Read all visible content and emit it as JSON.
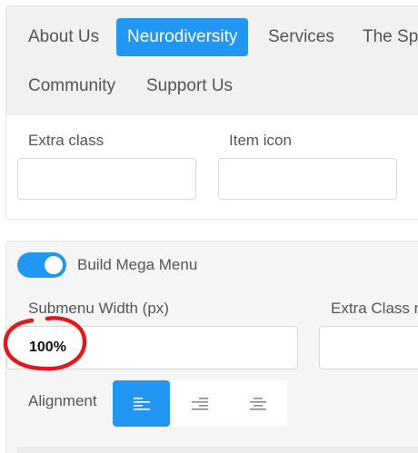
{
  "nav": {
    "items": [
      {
        "label": "About Us",
        "active": false
      },
      {
        "label": "Neurodiversity",
        "active": true
      },
      {
        "label": "Services",
        "active": false
      },
      {
        "label": "The Sp",
        "active": false
      },
      {
        "label": "Community",
        "active": false
      },
      {
        "label": "Support Us",
        "active": false
      }
    ]
  },
  "item_settings": {
    "extra_class_label": "Extra class",
    "extra_class_value": "",
    "item_icon_label": "Item icon",
    "item_icon_value": ""
  },
  "mega_menu": {
    "toggle_label": "Build Mega Menu",
    "toggle_on": true,
    "submenu_width_label": "Submenu Width (px)",
    "submenu_width_value": "100%",
    "extra_class_label": "Extra Class n",
    "extra_class_value": "",
    "alignment_label": "Alignment",
    "alignment_options": [
      "left",
      "right",
      "center"
    ],
    "alignment_selected": "left"
  },
  "colors": {
    "accent": "#2196f3",
    "annotation": "#e0191f"
  }
}
